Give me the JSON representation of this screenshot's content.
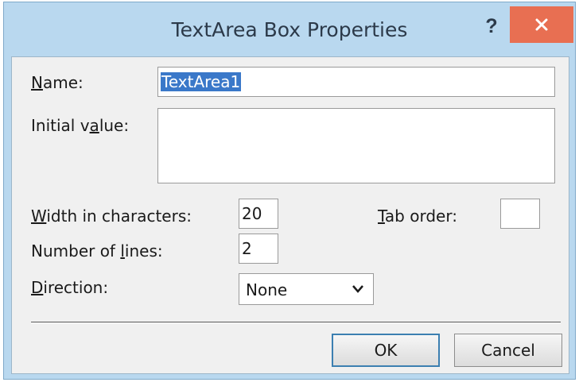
{
  "window": {
    "title": "TextArea Box Properties",
    "help_label": "?"
  },
  "form": {
    "name_label_pre": "N",
    "name_label_rest": "ame:",
    "name_value": "TextArea1",
    "initial_value_label_pre": "Initial v",
    "initial_value_label_accel": "a",
    "initial_value_label_rest": "lue:",
    "initial_value": "",
    "width_label_pre": "W",
    "width_label_rest": "idth in characters:",
    "width_value": "20",
    "tab_order_label_pre": "T",
    "tab_order_label_rest": "ab order:",
    "tab_order_value": "",
    "lines_label_pre": "Number of ",
    "lines_label_accel": "l",
    "lines_label_rest": "ines:",
    "lines_value": "2",
    "direction_label_pre": "D",
    "direction_label_rest": "irection:",
    "direction_value": "None"
  },
  "buttons": {
    "ok_label": "OK",
    "cancel_label": "Cancel"
  },
  "colors": {
    "titlebar": "#b9d8ef",
    "close_button": "#e86f52",
    "selection": "#3a78c9",
    "client_background": "#f0f0f0"
  }
}
